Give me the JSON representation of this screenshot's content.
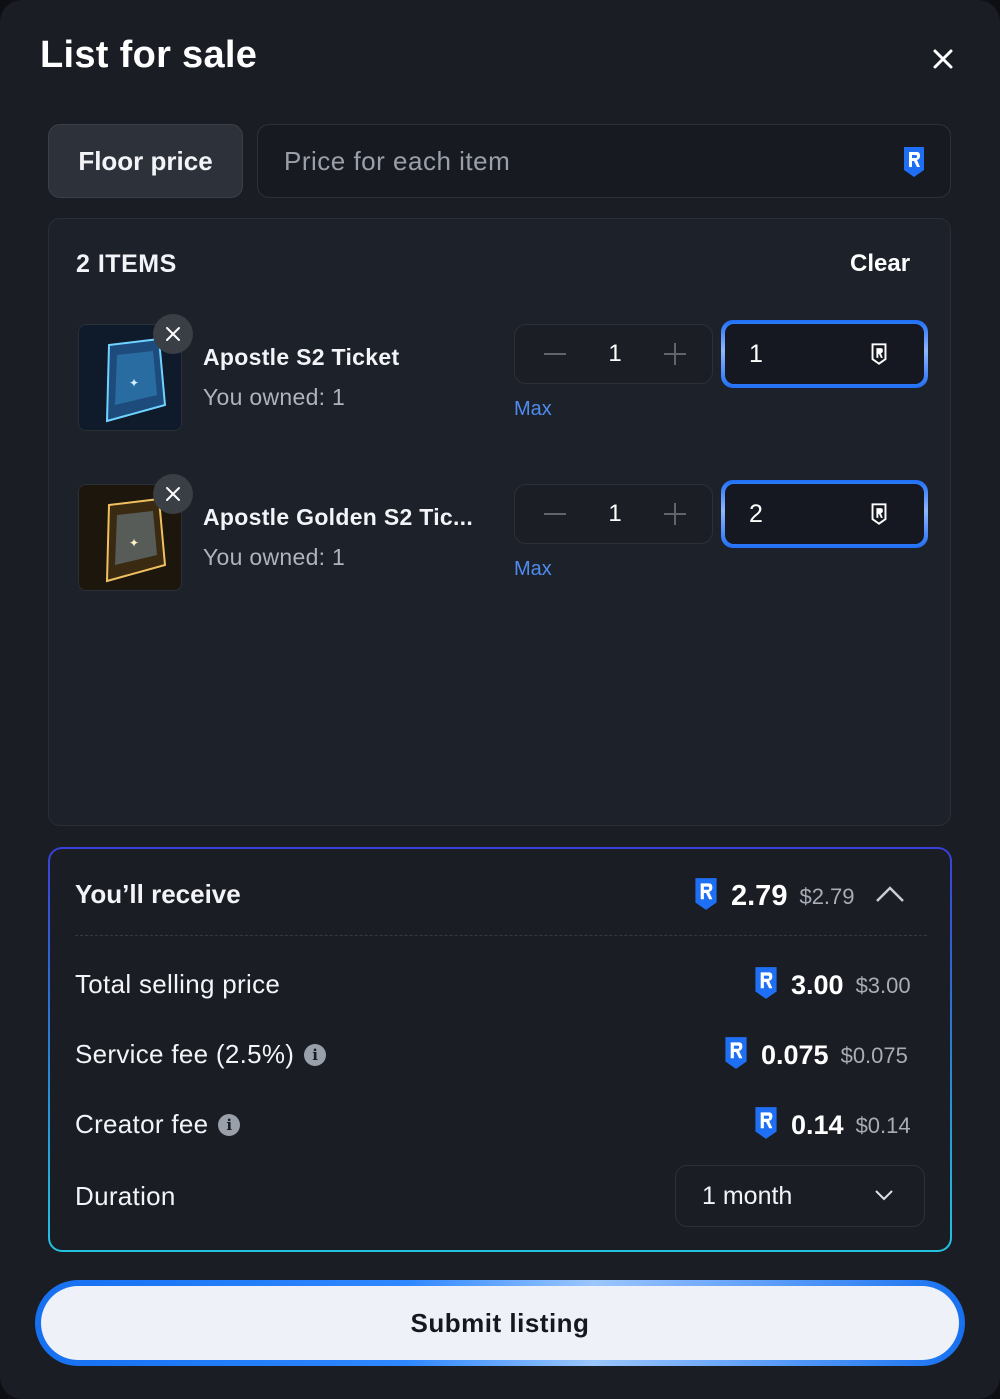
{
  "dialog": {
    "title": "List for sale",
    "close_icon": "close-icon"
  },
  "pricing": {
    "floor_price_label": "Floor price",
    "price_placeholder": "Price for each item",
    "currency_icon": "ron-token-icon"
  },
  "items_panel": {
    "count_label": "2 ITEMS",
    "clear_label": "Clear",
    "items": [
      {
        "name": "Apostle S2 Ticket",
        "owned": "You owned: 1",
        "quantity": "1",
        "max_label": "Max",
        "price": "1",
        "thumb_colors": [
          "#1b3a66",
          "#5fd3ff"
        ]
      },
      {
        "name": "Apostle Golden S2 Tic...",
        "owned": "You owned: 1",
        "quantity": "1",
        "max_label": "Max",
        "price": "2",
        "thumb_colors": [
          "#4a3618",
          "#f0c060"
        ]
      }
    ]
  },
  "receive": {
    "label": "You’ll receive",
    "amount": "2.79",
    "usd": "$2.79",
    "rows": [
      {
        "label": "Total selling price",
        "amount": "3.00",
        "usd": "$3.00"
      },
      {
        "label": "Service fee (2.5%)",
        "amount": "0.075",
        "usd": "$0.075"
      },
      {
        "label": "Creator fee",
        "amount": "0.14",
        "usd": "$0.14"
      }
    ],
    "duration_label": "Duration",
    "duration_value": "1 month"
  },
  "actions": {
    "submit_label": "Submit listing"
  },
  "colors": {
    "accent": "#1f6ff5",
    "link": "#4e8cf0",
    "background": "#1a1d24"
  }
}
